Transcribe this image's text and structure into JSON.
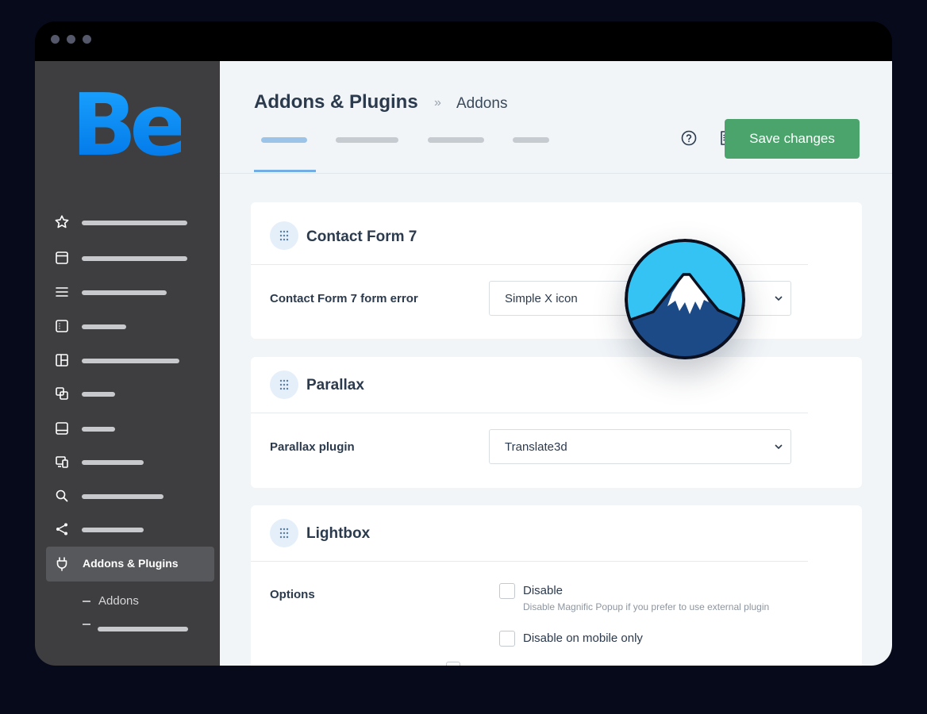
{
  "window": {
    "controls": [
      "dot-1",
      "dot-2",
      "dot-3"
    ]
  },
  "sidebar": {
    "logo": "Be",
    "logo_colors": [
      "#1aa3ff",
      "#0074e6"
    ],
    "items": [
      {
        "icon": "star-icon"
      },
      {
        "icon": "window-icon"
      },
      {
        "icon": "menu-icon"
      },
      {
        "icon": "list-panel-icon"
      },
      {
        "icon": "layout-icon"
      },
      {
        "icon": "copy-icon"
      },
      {
        "icon": "footer-icon"
      },
      {
        "icon": "responsive-icon"
      },
      {
        "icon": "search-icon"
      },
      {
        "icon": "share-icon"
      },
      {
        "icon": "plug-icon",
        "label": "Addons & Plugins",
        "active": true
      }
    ],
    "subitems": [
      {
        "label": "Addons"
      },
      {
        "label": ""
      }
    ]
  },
  "header": {
    "title": "Addons & Plugins",
    "separator": "»",
    "current": "Addons",
    "tabs_count_active": 1,
    "help_icon": "help-circle-icon",
    "notes_icon": "notes-icon",
    "save_label": "Save changes",
    "accent": "#4aa46c"
  },
  "cards": {
    "contact": {
      "title": "Contact Form 7",
      "row_label": "Contact Form 7 form error",
      "value": "Simple X icon"
    },
    "parallax": {
      "title": "Parallax",
      "row_label": "Parallax plugin",
      "value": "Translate3d"
    },
    "lightbox": {
      "title": "Lightbox",
      "row_label": "Options",
      "disable_label": "Disable",
      "disable_desc": "Disable Magnific Popup if you prefer to use external plugin",
      "disable_mobile_label": "Disable on mobile only"
    }
  },
  "badge": {
    "icon": "mountain-logo-icon",
    "colors": [
      "#34c3f2",
      "#1b4a86"
    ]
  }
}
